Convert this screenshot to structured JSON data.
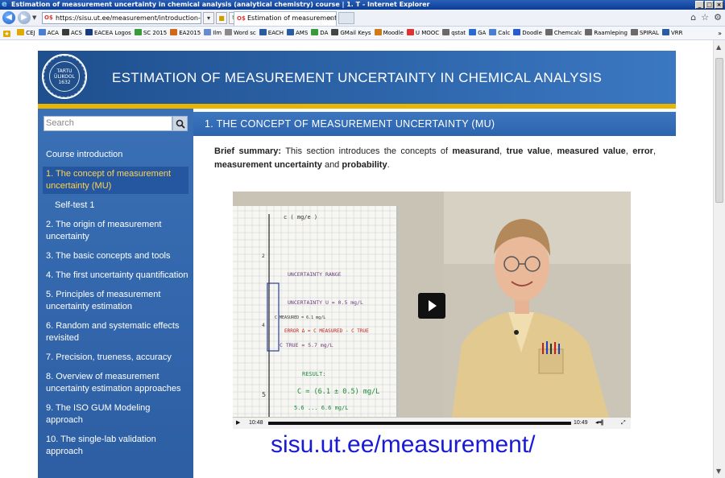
{
  "window": {
    "title": "Estimation of measurement uncertainty in chemical analysis (analytical chemistry) course | 1. T - Internet Explorer",
    "controls": [
      "_",
      "×"
    ]
  },
  "browser": {
    "address_url": "https://sisu.ut.ee/measurement/introduction-conce",
    "tab_title": "Estimation of measurement u...",
    "tab_close": "×"
  },
  "favorites": [
    "CEJ",
    "ACA",
    "ACS",
    "EACEA Logos",
    "SC 2015",
    "EA2015",
    "Ilm",
    "Word sc",
    "EACH",
    "AMS",
    "DA",
    "GMail Keys",
    "Moodle",
    "U MOOC",
    "qstat",
    "GA",
    "Calc",
    "Doodle",
    "Chemcalc",
    "Raamleping",
    "SPIRAL",
    "VRR"
  ],
  "site": {
    "title": "ESTIMATION OF MEASUREMENT UNCERTAINTY  IN CHEMICAL ANALYSIS",
    "logo_text": "TARTU ÜLIKOOL 1632"
  },
  "search": {
    "placeholder": "Search"
  },
  "menu": [
    {
      "label": "Course introduction",
      "active": false,
      "sub": false
    },
    {
      "label": "1. The concept of measurement uncertainty (MU)",
      "active": true,
      "sub": false
    },
    {
      "label": "Self-test 1",
      "active": false,
      "sub": true
    },
    {
      "label": "2. The origin of measurement uncertainty",
      "active": false,
      "sub": false
    },
    {
      "label": "3. The basic concepts and tools",
      "active": false,
      "sub": false
    },
    {
      "label": "4. The first uncertainty quantification",
      "active": false,
      "sub": false
    },
    {
      "label": "5. Principles of measurement uncertainty estimation",
      "active": false,
      "sub": false
    },
    {
      "label": "6. Random and systematic effects revisited",
      "active": false,
      "sub": false
    },
    {
      "label": "7. Precision, trueness, accuracy",
      "active": false,
      "sub": false
    },
    {
      "label": "8. Overview of measurement uncertainty estimation approaches",
      "active": false,
      "sub": false
    },
    {
      "label": "9. The ISO GUM Modeling approach",
      "active": false,
      "sub": false
    },
    {
      "label": "10. The single-lab validation approach",
      "active": false,
      "sub": false
    }
  ],
  "section": {
    "heading": "1. THE CONCEPT OF MEASUREMENT UNCERTAINTY (MU)",
    "summary_label": "Brief summary:",
    "summary_text_1": " This section introduces the concepts of ",
    "term_1": "measurand",
    "sep_1": ", ",
    "term_2": "true value",
    "sep_2": ", ",
    "term_3": "measured value",
    "sep_3": ", ",
    "term_4": "error",
    "sep_4": ", ",
    "term_5": "measurement uncertainty",
    "summary_text_2": " and ",
    "term_6": "probability",
    "summary_end": "."
  },
  "video": {
    "time_current": "10:48",
    "time_total": "10:49",
    "progress": 0.998,
    "whiteboard": {
      "axis_label": "c ( mg/e )",
      "tick_2": "2",
      "tick_4": "4",
      "tick_5": "5",
      "line_1": "UNCERTAINTY RANGE",
      "line_2": "UNCERTAINTY  U = 0.5 mg/L",
      "line_3": "C MEASURED = 6.1 mg/L",
      "line_4": "ERROR  Δ = C MEASURED - C TRUE",
      "line_5": "C TRUE = 5.7 mg/L",
      "line_6": "RESULT:",
      "line_7": "C = (6.1 ± 0.5) mg/L",
      "line_8": "5.6 ... 6.6 mg/L"
    }
  },
  "caption_url": "sisu.ut.ee/measurement/",
  "colors": {
    "banner": "#2a62aa",
    "gold": "#e8b600",
    "sidebar": "#3466ad",
    "active_link": "#ffd34d",
    "url_text": "#1a1ad6"
  }
}
